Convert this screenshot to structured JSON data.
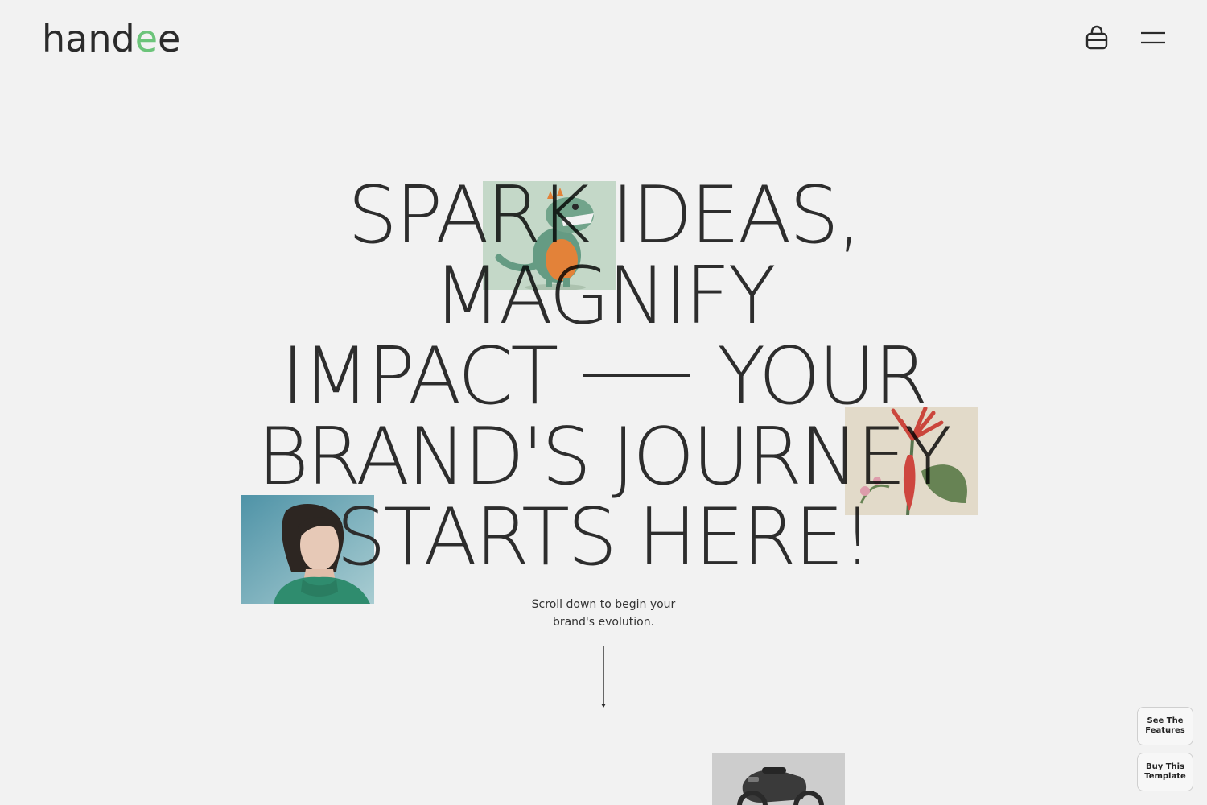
{
  "header": {
    "logo_prefix": "hand",
    "logo_accent": "e",
    "logo_suffix": "e",
    "accent_color": "#6cc47a",
    "cart_icon": "shopping-bag-icon",
    "menu_icon": "hamburger-menu-icon"
  },
  "hero": {
    "line1": "SPARK IDEAS,",
    "line2": "MAGNIFY",
    "line3_left": "IMPACT",
    "line3_right": "YOUR",
    "line4": "BRAND'S JOURNEY",
    "line5": "STARTS HERE!",
    "subtext_line1": "Scroll down to begin your",
    "subtext_line2": "brand's evolution."
  },
  "floating_buttons": {
    "features_line1": "See The",
    "features_line2": "Features",
    "buy_line1": "Buy This",
    "buy_line2": "Template"
  },
  "images": [
    "dinosaur-illustration",
    "flower-illustration",
    "woman-portrait",
    "scooter-photo"
  ]
}
